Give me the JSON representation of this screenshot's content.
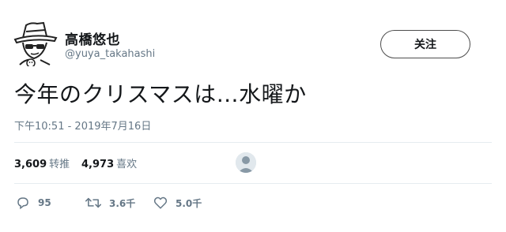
{
  "user": {
    "display_name": "高橋悠也",
    "handle": "@yuya_takahashi"
  },
  "follow_button": {
    "label": "关注"
  },
  "tweet": {
    "text": "今年のクリスマスは…水曜か",
    "timestamp": "下午10:51 - 2019年7月16日"
  },
  "stats": {
    "retweets": {
      "count": "3,609",
      "label": "转推"
    },
    "likes": {
      "count": "4,973",
      "label": "喜欢"
    }
  },
  "actions": {
    "reply": {
      "count": "95",
      "icon": "reply-icon"
    },
    "retweet": {
      "count": "3.6千",
      "icon": "retweet-icon"
    },
    "like": {
      "count": "5.0千",
      "icon": "heart-icon"
    }
  },
  "colors": {
    "text": "#14171a",
    "secondary": "#657786",
    "divider": "#e6ecf0"
  }
}
